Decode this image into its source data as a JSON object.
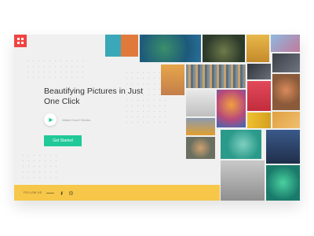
{
  "hero": {
    "title": "Beautifying Pictures in Just One Click",
    "how_it_works": "Watch How It Works",
    "cta": "Get Started"
  },
  "footer": {
    "follow_label": "FOLLOW US"
  },
  "icons": {
    "menu": "grid-menu-icon",
    "play": "play-icon",
    "facebook": "facebook-icon",
    "instagram": "instagram-icon"
  },
  "colors": {
    "menu_button": "#f04343",
    "cta": "#20c997",
    "footer": "#f7c74a",
    "background": "#f0f0f0"
  }
}
